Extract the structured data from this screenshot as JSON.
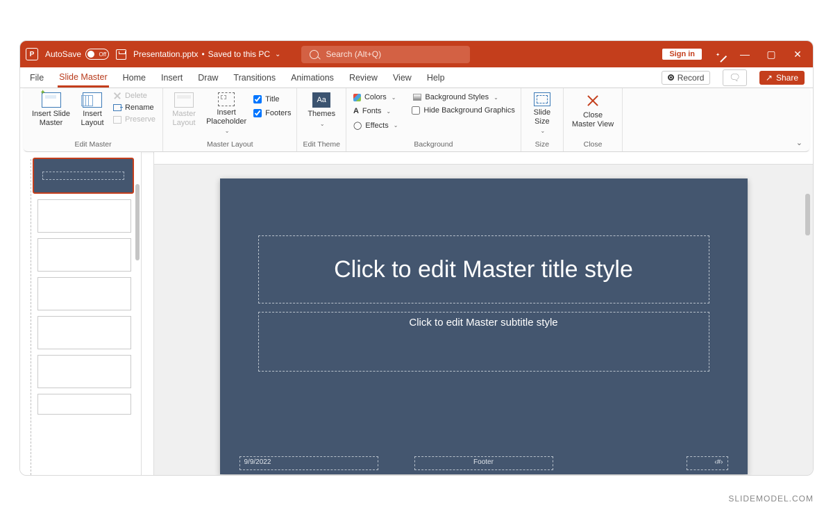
{
  "titlebar": {
    "autosave_label": "AutoSave",
    "autosave_state": "Off",
    "doc_name": "Presentation.pptx",
    "save_status": "Saved to this PC",
    "search_placeholder": "Search (Alt+Q)",
    "signin": "Sign in"
  },
  "tabs": {
    "file": "File",
    "slide_master": "Slide Master",
    "home": "Home",
    "insert": "Insert",
    "draw": "Draw",
    "transitions": "Transitions",
    "animations": "Animations",
    "review": "Review",
    "view": "View",
    "help": "Help",
    "record": "Record",
    "share": "Share"
  },
  "ribbon": {
    "edit_master": {
      "insert_slide_master": "Insert Slide\nMaster",
      "insert_layout": "Insert\nLayout",
      "delete": "Delete",
      "rename": "Rename",
      "preserve": "Preserve",
      "group": "Edit Master"
    },
    "master_layout": {
      "master_layout": "Master\nLayout",
      "insert_placeholder": "Insert\nPlaceholder",
      "title": "Title",
      "footers": "Footers",
      "group": "Master Layout"
    },
    "edit_theme": {
      "themes": "Themes",
      "group": "Edit Theme"
    },
    "background": {
      "colors": "Colors",
      "fonts": "Fonts",
      "effects": "Effects",
      "bg_styles": "Background Styles",
      "hide_bg": "Hide Background Graphics",
      "group": "Background"
    },
    "size": {
      "slide_size": "Slide\nSize",
      "group": "Size"
    },
    "close": {
      "close_master": "Close\nMaster View",
      "group": "Close"
    }
  },
  "slide": {
    "title": "Click to edit Master title style",
    "subtitle": "Click to edit Master subtitle style",
    "date": "9/9/2022",
    "footer": "Footer",
    "slidenum": "‹#›"
  },
  "watermark": "SLIDEMODEL.COM"
}
